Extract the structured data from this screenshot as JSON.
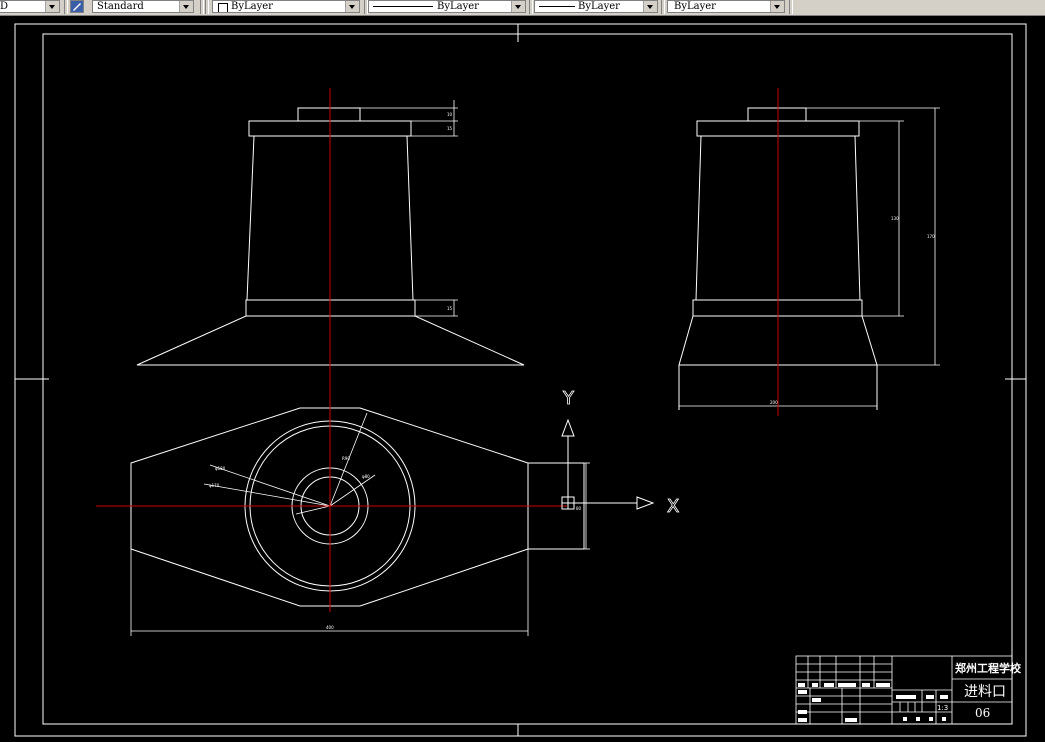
{
  "toolbar": {
    "first_value": "D",
    "text_style": "Standard",
    "layer_color": "ByLayer",
    "linetype": "ByLayer",
    "lineweight": "ByLayer",
    "plot_style": "ByLayer"
  },
  "ucs": {
    "y_label": "Y",
    "x_label": "X"
  },
  "title_block": {
    "school": "郑州工程学校",
    "part_name": "进料口",
    "drawing_no": "06",
    "scale": "1:3"
  },
  "colors": {
    "background": "#000000",
    "lines": "#ffffff",
    "centerline": "#cc0000"
  }
}
